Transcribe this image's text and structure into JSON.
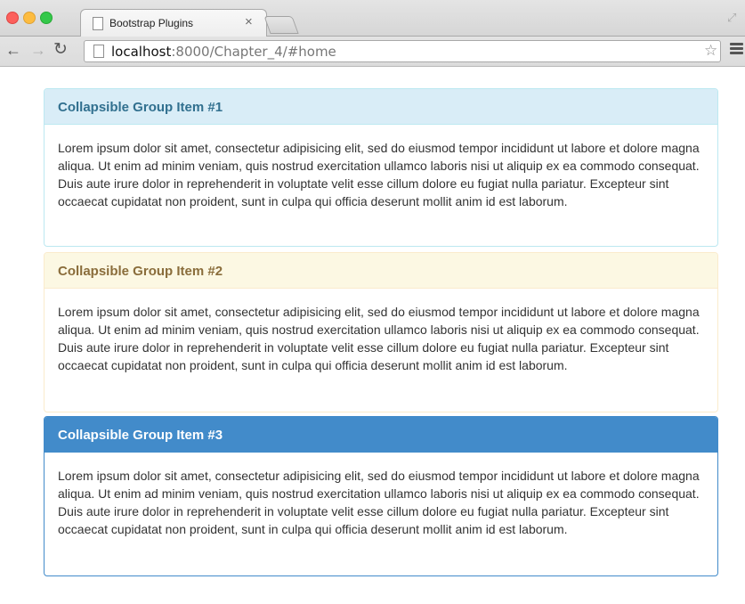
{
  "browser": {
    "tab_title": "Bootstrap Plugins",
    "tab_close": "×",
    "url_host": "localhost",
    "url_rest": ":8000/Chapter_4/#home",
    "icons": [
      "back-arrow-icon",
      "forward-arrow-icon",
      "reload-icon",
      "page-icon",
      "star-icon",
      "menu-icon"
    ]
  },
  "panels": [
    {
      "title": "Collapsible Group Item #1",
      "style": "info",
      "body": "Lorem ipsum dolor sit amet, consectetur adipisicing elit, sed do eiusmod tempor incididunt ut labore et dolore magna aliqua. Ut enim ad minim veniam, quis nostrud exercitation ullamco laboris nisi ut aliquip ex ea commodo consequat. Duis aute irure dolor in reprehenderit in voluptate velit esse cillum dolore eu fugiat nulla pariatur. Excepteur sint occaecat cupidatat non proident, sunt in culpa qui officia deserunt mollit anim id est laborum."
    },
    {
      "title": "Collapsible Group Item #2",
      "style": "warning",
      "body": "Lorem ipsum dolor sit amet, consectetur adipisicing elit, sed do eiusmod tempor incididunt ut labore et dolore magna aliqua. Ut enim ad minim veniam, quis nostrud exercitation ullamco laboris nisi ut aliquip ex ea commodo consequat. Duis aute irure dolor in reprehenderit in voluptate velit esse cillum dolore eu fugiat nulla pariatur. Excepteur sint occaecat cupidatat non proident, sunt in culpa qui officia deserunt mollit anim id est laborum."
    },
    {
      "title": "Collapsible Group Item #3",
      "style": "primary",
      "body": "Lorem ipsum dolor sit amet, consectetur adipisicing elit, sed do eiusmod tempor incididunt ut labore et dolore magna aliqua. Ut enim ad minim veniam, quis nostrud exercitation ullamco laboris nisi ut aliquip ex ea commodo consequat. Duis aute irure dolor in reprehenderit in voluptate velit esse cillum dolore eu fugiat nulla pariatur. Excepteur sint occaecat cupidatat non proident, sunt in culpa qui officia deserunt mollit anim id est laborum."
    }
  ],
  "colors": {
    "info_heading_bg": "#d9edf7",
    "info_heading_text": "#31708f",
    "warning_heading_bg": "#fcf8e3",
    "warning_heading_text": "#8a6d3b",
    "primary_heading_bg": "#428bca",
    "primary_heading_text": "#ffffff"
  }
}
